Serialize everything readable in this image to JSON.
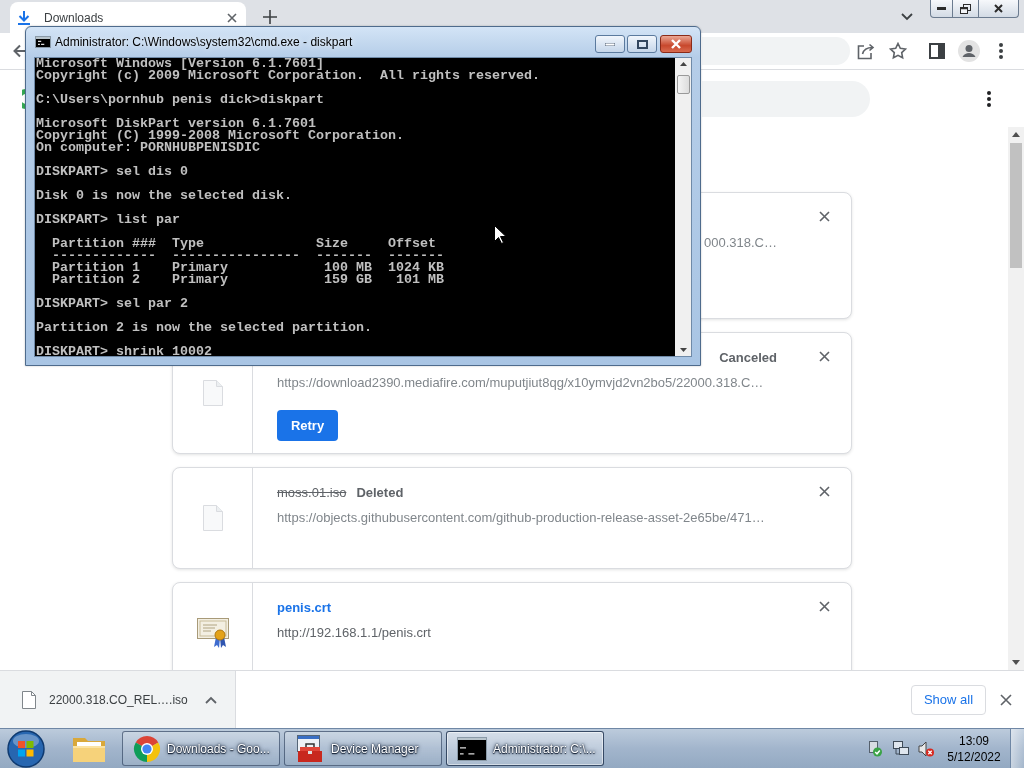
{
  "browser": {
    "tabs": [
      {
        "title": "Downloads",
        "selected": true
      }
    ],
    "downloads": {
      "items": [
        {
          "kind": "covered",
          "url": "000.318.C…"
        },
        {
          "kind": "canceled",
          "status": "Canceled",
          "url": "https://download2390.mediafire.com/muputjiut8qg/x10ymvjd2vn2bo5/22000.318.C…",
          "button": "Retry"
        },
        {
          "kind": "deleted",
          "name": "moss.01.iso",
          "status": "Deleted",
          "url": "https://objects.githubusercontent.com/github-production-release-asset-2e65be/471…"
        },
        {
          "kind": "completed",
          "name": "penis.crt",
          "url": "http://192.168.1.1/penis.crt"
        }
      ]
    },
    "shelf": {
      "items": [
        {
          "name": "22000.318.CO_REL….iso"
        }
      ],
      "show_all": "Show all"
    }
  },
  "console_window": {
    "title": "Administrator: C:\\Windows\\system32\\cmd.exe - diskpart",
    "output": [
      "Microsoft Windows [Version 6.1.7601]\nCopyright (c) 2009 Microsoft Corporation.  All rights reserved.",
      "C:\\Users\\pornhub penis dick>diskpart",
      "Microsoft DiskPart version 6.1.7601\nCopyright (C) 1999-2008 Microsoft Corporation.\nOn computer: PORNHUBPENISDIC",
      "DISKPART> sel dis 0",
      "Disk 0 is now the selected disk.",
      "DISKPART> list par",
      "  Partition ###  Type              Size     Offset\n  -------------  ----------------  -------  -------\n  Partition 1    Primary            100 MB  1024 KB\n  Partition 2    Primary            159 GB   101 MB",
      "DISKPART> sel par 2",
      "Partition 2 is now the selected partition.",
      "DISKPART> shrink 10002"
    ]
  },
  "taskbar": {
    "buttons": [
      {
        "label": "Downloads - Goo...",
        "selected": false
      },
      {
        "label": "Device Manager",
        "selected": false
      },
      {
        "label": "Administrator: C:\\...",
        "selected": true
      }
    ],
    "clock": {
      "time": "13:09",
      "date": "5/12/2022"
    }
  }
}
